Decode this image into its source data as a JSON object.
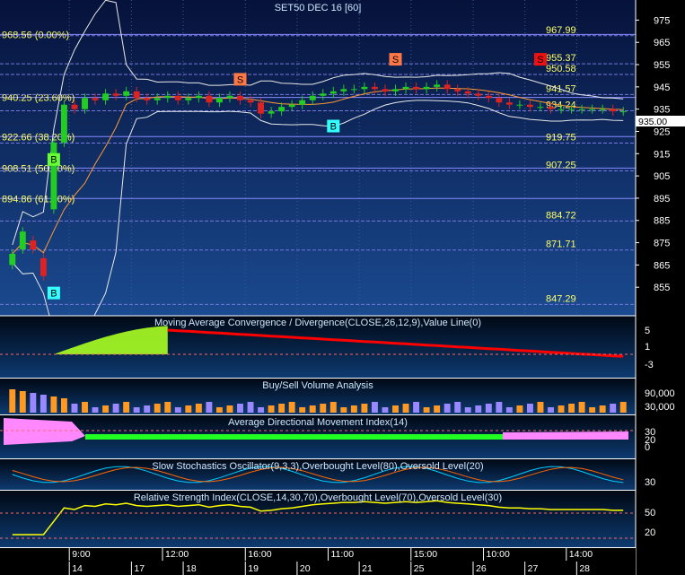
{
  "title": "SET50 DEC 16  [60]",
  "price_axis": {
    "ticks": [
      "975",
      "965",
      "955",
      "945",
      "935",
      "925",
      "915",
      "905",
      "895",
      "885",
      "875",
      "865",
      "855"
    ],
    "last_price": "935.00"
  },
  "fib_labels": [
    {
      "text": "968.56 (0.00%)",
      "value": 968.56
    },
    {
      "text": "940.25 (23.60%)",
      "value": 940.25
    },
    {
      "text": "922.66 (38.20%)",
      "value": 922.66
    },
    {
      "text": "908.51 (50.00%)",
      "value": 908.51
    },
    {
      "text": "894.86 (61.80%)",
      "value": 894.86
    }
  ],
  "level_labels": [
    {
      "text": "967.99",
      "value": 967.99
    },
    {
      "text": "955.37",
      "value": 955.37
    },
    {
      "text": "950.58",
      "value": 950.58
    },
    {
      "text": "941.57",
      "value": 941.57
    },
    {
      "text": "934.24",
      "value": 934.24
    },
    {
      "text": "919.75",
      "value": 919.75
    },
    {
      "text": "907.25",
      "value": 907.25
    },
    {
      "text": "884.72",
      "value": 884.72
    },
    {
      "text": "871.71",
      "value": 871.71
    },
    {
      "text": "847.29",
      "value": 847.29
    }
  ],
  "signals": [
    {
      "text": "B",
      "kind": "buy-green",
      "bar": 4,
      "value": 912
    },
    {
      "text": "B",
      "kind": "buy-cyan",
      "bar": 4,
      "value": 852
    },
    {
      "text": "S",
      "kind": "sell-orange",
      "bar": 22,
      "value": 948
    },
    {
      "text": "B",
      "kind": "buy-cyan",
      "bar": 31,
      "value": 927
    },
    {
      "text": "S",
      "kind": "sell-orange",
      "bar": 37,
      "value": 957
    },
    {
      "text": "S",
      "kind": "sell-red",
      "bar": 51,
      "value": 957
    }
  ],
  "panels": {
    "macd": {
      "title": "Moving Average Convergence / Divergence(CLOSE,26,12,9),Value Line(0)",
      "ticks": [
        "5",
        "1",
        "-3"
      ]
    },
    "volume": {
      "title": "Buy/Sell Volume Analysis",
      "ticks": [
        "90,000",
        "30,000"
      ]
    },
    "adx": {
      "title": "Average Directional Movement Index(14)",
      "ticks": [
        "30",
        "20",
        "0"
      ]
    },
    "stoch": {
      "title": "Slow Stochastics Oscillator(9,3,3),Overbought Level(80),Oversold Level(20)",
      "ticks": [
        "30"
      ]
    },
    "rsi": {
      "title": "Relative Strength Index(CLOSE,14,30,70),Overbought Level(70),Oversold Level(30)",
      "ticks": [
        "50",
        "20"
      ]
    }
  },
  "time_axis": {
    "times": [
      {
        "text": "9:00",
        "bar": 6
      },
      {
        "text": "12:00",
        "bar": 15
      },
      {
        "text": "16:00",
        "bar": 23
      },
      {
        "text": "11:00",
        "bar": 31
      },
      {
        "text": "15:00",
        "bar": 39
      },
      {
        "text": "10:00",
        "bar": 46
      },
      {
        "text": "14:00",
        "bar": 54
      }
    ],
    "dates": [
      {
        "text": "14",
        "bar": 6
      },
      {
        "text": "17",
        "bar": 12
      },
      {
        "text": "18",
        "bar": 17
      },
      {
        "text": "19",
        "bar": 23
      },
      {
        "text": "20",
        "bar": 28
      },
      {
        "text": "21",
        "bar": 34
      },
      {
        "text": "25",
        "bar": 39
      },
      {
        "text": "26",
        "bar": 45
      },
      {
        "text": "27",
        "bar": 50
      },
      {
        "text": "28",
        "bar": 55
      }
    ]
  },
  "colors": {
    "up": "#22cc22",
    "down": "#dd2222",
    "bollinger": "#e8e8e8",
    "fib": "#8888ff",
    "macd_hist": "#aaff22",
    "macd_line": "#ff0000",
    "vol_buy": "#ff9922",
    "vol_sell": "#9988ff",
    "adx_pos": "#22ff22",
    "adx_neg": "#ff88ff",
    "stoch_k": "#00ccff",
    "stoch_d": "#ff6600",
    "rsi": "#ffff00",
    "label": "#ffff66"
  },
  "chart_data": {
    "type": "candlestick",
    "ylim": [
      845,
      980
    ],
    "closes": [
      870,
      880,
      872,
      860,
      920,
      937,
      935,
      940,
      939,
      942,
      941,
      943,
      940,
      939,
      940,
      941,
      939,
      940,
      941,
      938,
      940,
      941,
      939,
      938,
      933,
      934,
      936,
      937,
      939,
      941,
      942,
      943,
      944,
      944,
      945,
      944,
      943,
      944,
      945,
      944,
      945,
      946,
      944,
      943,
      942,
      941,
      940,
      938,
      937,
      937,
      936,
      936,
      935,
      935,
      935,
      935,
      935,
      935,
      934,
      934
    ],
    "opens": [
      865,
      872,
      876,
      868,
      890,
      920,
      937,
      935,
      940,
      939,
      942,
      941,
      943,
      940,
      939,
      940,
      941,
      939,
      940,
      941,
      938,
      940,
      941,
      939,
      938,
      933,
      934,
      936,
      937,
      939,
      941,
      942,
      943,
      944,
      944,
      945,
      944,
      943,
      944,
      945,
      944,
      945,
      946,
      944,
      943,
      942,
      941,
      940,
      938,
      937,
      937,
      936,
      936,
      935,
      935,
      935,
      935,
      935,
      935,
      934
    ]
  }
}
